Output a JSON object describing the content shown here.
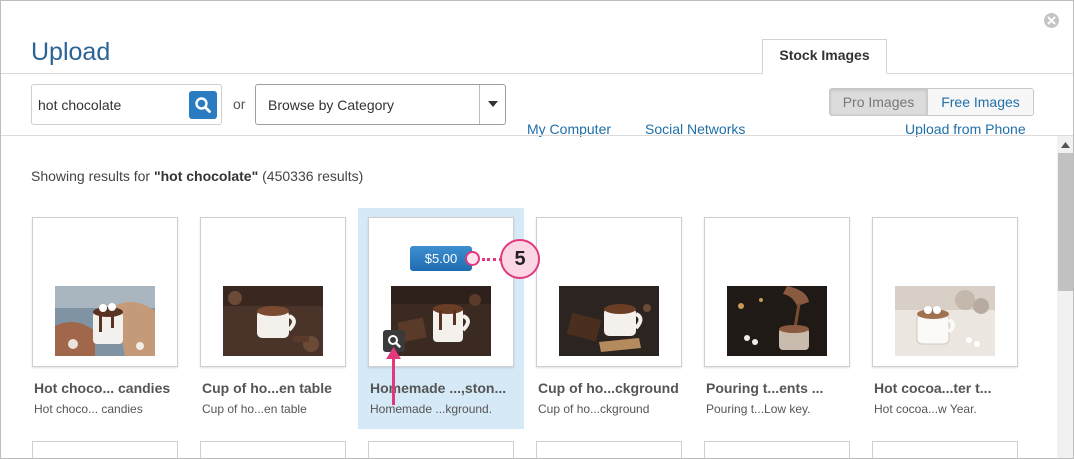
{
  "dialog": {
    "title": "Upload",
    "close_icon": "close-icon"
  },
  "tabs": [
    {
      "label": "My Computer",
      "active": false
    },
    {
      "label": "Social Networks",
      "active": false
    },
    {
      "label": "Stock Images",
      "active": true
    },
    {
      "label": "Upload from Phone",
      "active": false
    }
  ],
  "search": {
    "value": "hot chocolate",
    "icon": "search-icon"
  },
  "or_label": "or",
  "category": {
    "selected": "Browse by Category"
  },
  "filter": {
    "pro_label": "Pro Images",
    "free_label": "Free Images",
    "active": "Pro Images"
  },
  "results": {
    "prefix": "Showing results for ",
    "query": "\"hot chocolate\"",
    "count": " (450336 results)"
  },
  "cards": [
    {
      "title": "Hot choco... candies",
      "subtitle": "Hot choco... candies"
    },
    {
      "title": "Cup of ho...en table",
      "subtitle": "Cup of ho...en table"
    },
    {
      "title": "Homemade ...,ston...",
      "subtitle": "Homemade ...kground.",
      "price": "$5.00",
      "selected": true
    },
    {
      "title": "Cup of ho...ckground",
      "subtitle": "Cup of ho...ckground"
    },
    {
      "title": "Pouring t...ents ...",
      "subtitle": "Pouring t...Low key."
    },
    {
      "title": "Hot cocoa...ter t...",
      "subtitle": "Hot cocoa...w Year."
    }
  ],
  "callout": {
    "number": "5"
  },
  "colors": {
    "accent": "#1f6fa8",
    "callout": "#e2387e",
    "highlight": "#d6e9f7"
  }
}
